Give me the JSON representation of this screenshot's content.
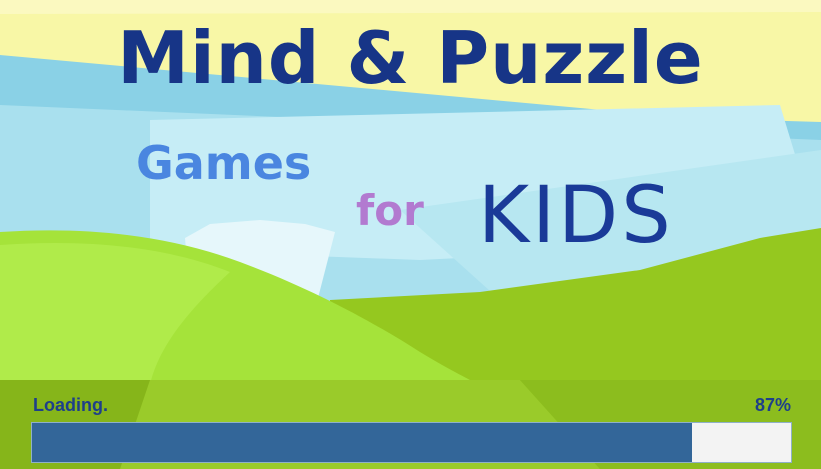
{
  "game": {
    "title_line1": "Mind & Puzzle",
    "title_games": "Games",
    "title_for": "for",
    "title_kids": "KIDS"
  },
  "loader": {
    "label": "Loading.",
    "percent_text": "87%",
    "progress": 0.87
  },
  "colors": {
    "title_main": "#173587",
    "title_games": "#4a86e0",
    "title_for": "#b27ad0",
    "title_kids": "#1a3a98",
    "loading_text": "#1e3f8a",
    "progress_fill": "#336699",
    "progress_track": "#f3f3f3"
  }
}
